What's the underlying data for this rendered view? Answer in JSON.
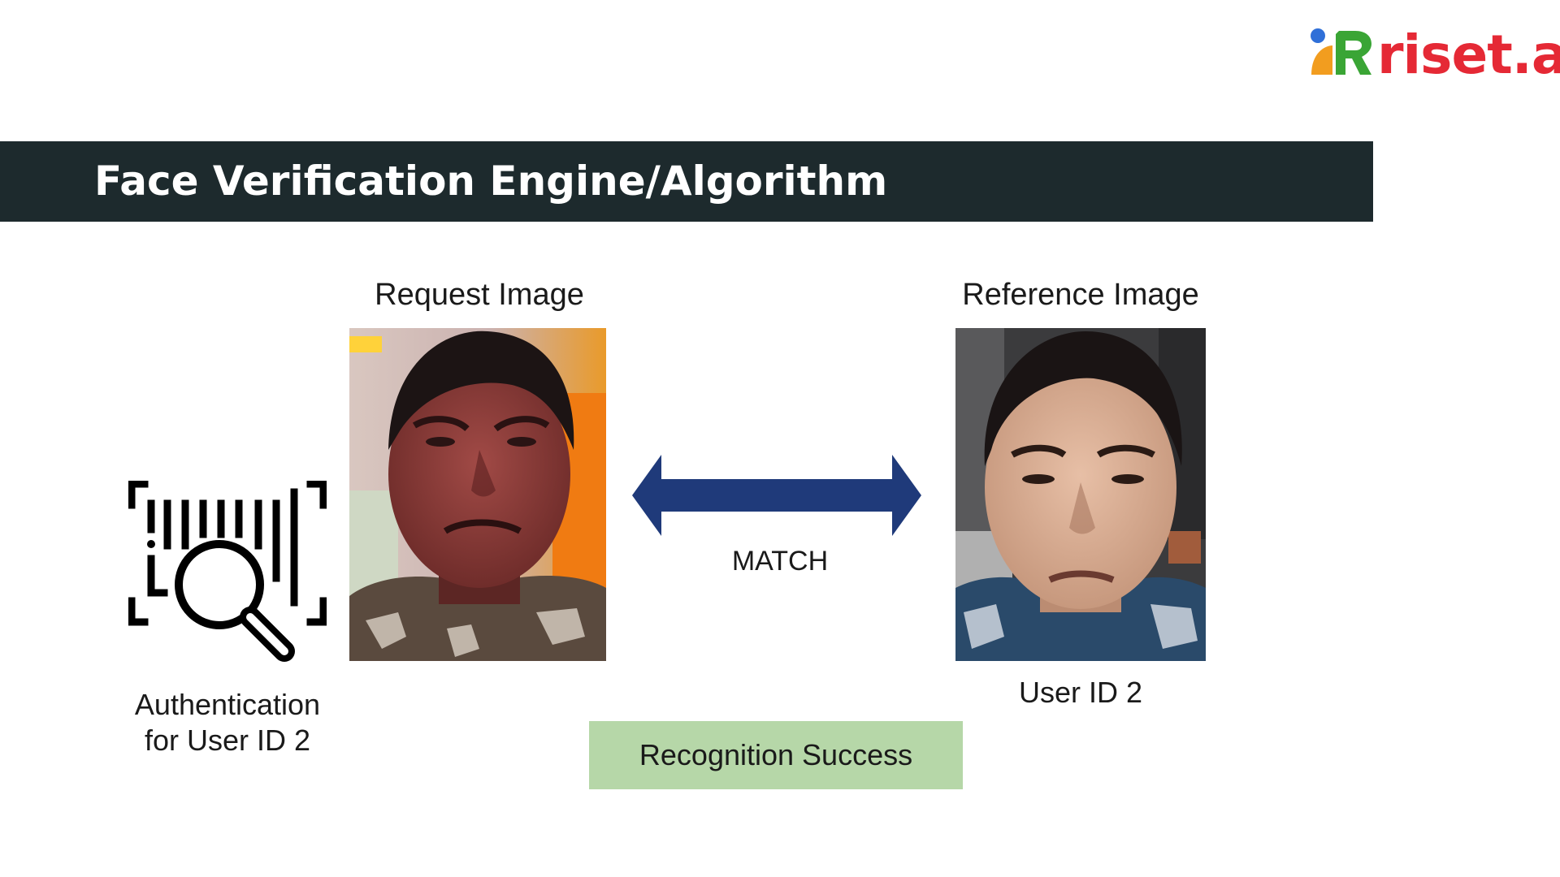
{
  "logo": {
    "text": "riset.ai",
    "colors": {
      "orange": "#f29d1f",
      "green": "#3aa535",
      "blue": "#2f6fd8",
      "red": "#e52935"
    }
  },
  "header": {
    "title": "Face Verification Engine/Algorithm",
    "background": "#1d2a2d"
  },
  "request": {
    "caption": "Request Image",
    "auth_line1": "Authentication",
    "auth_line2": "for User ID 2",
    "icon": "barcode-scan-icon"
  },
  "reference": {
    "caption": "Reference Image",
    "user_label": "User ID 2"
  },
  "match": {
    "label": "MATCH",
    "arrow_color": "#1f3a7a",
    "icon": "double-arrow-icon"
  },
  "result": {
    "label": "Recognition Success",
    "background": "#b6d7a8"
  }
}
